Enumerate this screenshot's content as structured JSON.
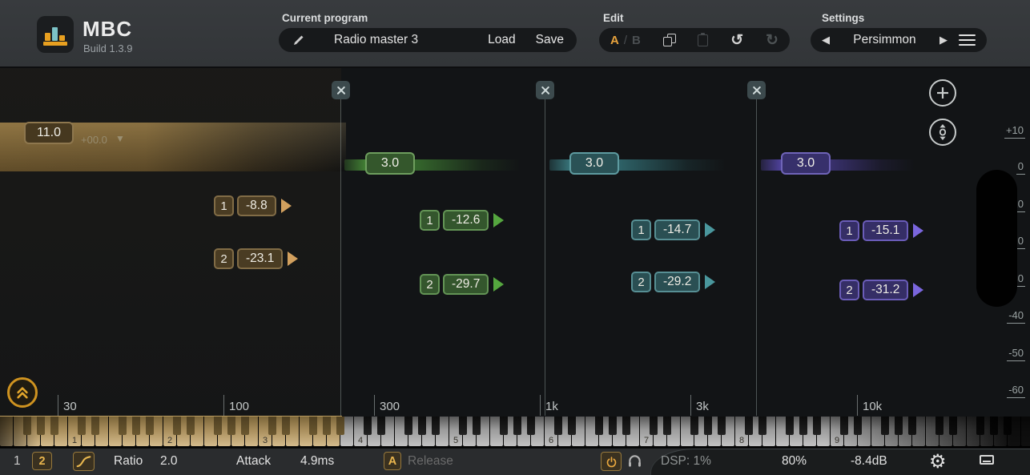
{
  "header": {
    "app_name": "MBC",
    "build": "Build 1.3.9",
    "program_label": "Current program",
    "program_name": "Radio master 3",
    "load": "Load",
    "save": "Save",
    "edit_label": "Edit",
    "ab_a": "A",
    "ab_sep": "/",
    "ab_b": "B",
    "settings_label": "Settings",
    "preset_name": "Persimmon"
  },
  "bands": [
    {
      "name": "low",
      "gain": "11.0",
      "offset": "+00.0",
      "thresholds": [
        {
          "num": "1",
          "value": "-8.8"
        },
        {
          "num": "2",
          "value": "-23.1"
        }
      ]
    },
    {
      "name": "low-mid",
      "gain": "3.0",
      "thresholds": [
        {
          "num": "1",
          "value": "-12.6"
        },
        {
          "num": "2",
          "value": "-29.7"
        }
      ]
    },
    {
      "name": "high-mid",
      "gain": "3.0",
      "thresholds": [
        {
          "num": "1",
          "value": "-14.7"
        },
        {
          "num": "2",
          "value": "-29.2"
        }
      ]
    },
    {
      "name": "high",
      "gain": "3.0",
      "thresholds": [
        {
          "num": "1",
          "value": "-15.1"
        },
        {
          "num": "2",
          "value": "-31.2"
        }
      ]
    }
  ],
  "db_scale": [
    "+10",
    "0",
    "-10",
    "-20",
    "-30",
    "-40",
    "-50",
    "-60"
  ],
  "freq_ticks": [
    "30",
    "100",
    "300",
    "1k",
    "3k",
    "10k"
  ],
  "keyboard": {
    "octave_labels": [
      "1",
      "2",
      "3",
      "4",
      "5",
      "6",
      "7",
      "8",
      "9"
    ]
  },
  "bottom_bar": {
    "channel_1": "1",
    "channel_2": "2",
    "ratio_label": "Ratio",
    "ratio_value": "2.0",
    "attack_label": "Attack",
    "attack_value": "4.9ms",
    "ab_button": "A",
    "release_label": "Release",
    "dsp": "DSP: 1%",
    "quality": "80%",
    "output_gain": "-8.4dB"
  },
  "icons": {
    "undo": "↺",
    "redo": "↻",
    "gear": "⚙",
    "prev": "◀",
    "next": "▶",
    "dropdown": "▼"
  },
  "colors": {
    "band1": "#c79e58",
    "band2": "#4f9c3e",
    "band3": "#4a969c",
    "band4": "#7766d8",
    "accent": "#e8a83d"
  }
}
